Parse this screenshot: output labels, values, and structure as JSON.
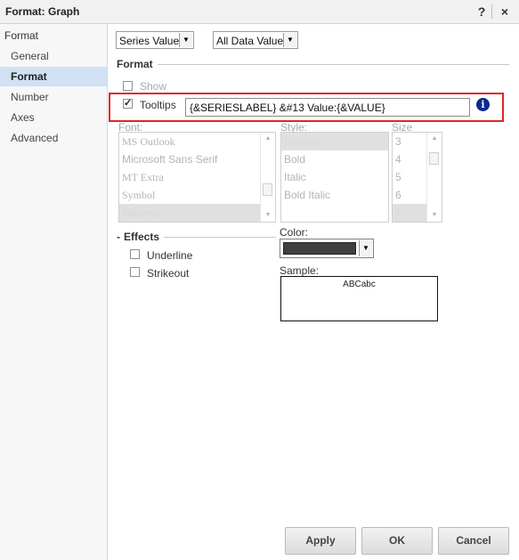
{
  "window": {
    "title": "Format: Graph",
    "help_label": "?",
    "close_label": "×"
  },
  "sidebar": {
    "root_label": "Format",
    "items": [
      {
        "label": "General",
        "active": false
      },
      {
        "label": "Format",
        "active": true
      },
      {
        "label": "Number",
        "active": false
      },
      {
        "label": "Axes",
        "active": false
      },
      {
        "label": "Advanced",
        "active": false
      }
    ]
  },
  "selectors": {
    "target": "Series Values",
    "scope": "All Data Values"
  },
  "format_section": {
    "title": "Format",
    "show_label": "Show",
    "show_checked": false,
    "tooltips_label": "Tooltips",
    "tooltips_checked": true,
    "tooltips_value": "{&SERIESLABEL} &#13 Value:{&VALUE}"
  },
  "font": {
    "font_label": "Font:",
    "fonts": [
      "MS Outlook",
      "Microsoft Sans Serif",
      "MT Extra",
      "Symbol",
      "Tahoma"
    ],
    "selected_font": "Tahoma",
    "style_label": "Style:",
    "styles": [
      "Regular",
      "Bold",
      "Italic",
      "Bold Italic"
    ],
    "selected_style": "Regular",
    "size_label": "Size",
    "sizes": [
      "3",
      "4",
      "5",
      "6",
      "7"
    ],
    "selected_size": "7"
  },
  "effects": {
    "title": "Effects",
    "underline_label": "Underline",
    "strikeout_label": "Strikeout"
  },
  "color": {
    "label": "Color:",
    "value": "#3f3f3f"
  },
  "sample": {
    "label": "Sample:",
    "text": "ABCabc"
  },
  "buttons": {
    "apply": "Apply",
    "ok": "OK",
    "cancel": "Cancel"
  }
}
